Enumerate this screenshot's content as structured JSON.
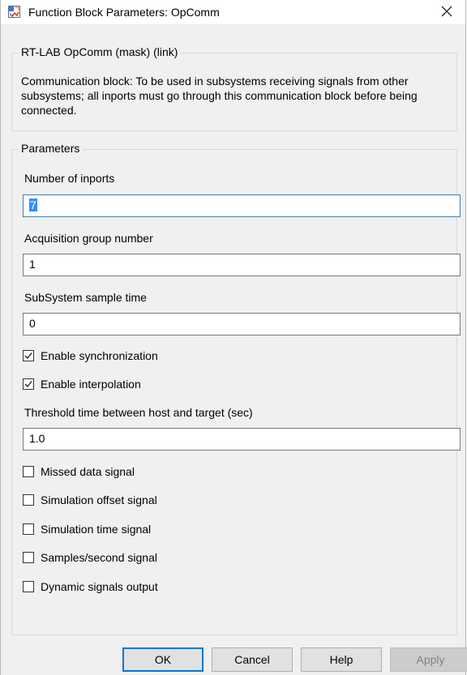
{
  "window": {
    "title": "Function Block Parameters: OpComm",
    "close_glyph": "✕"
  },
  "mask_group": {
    "legend": "RT-LAB OpComm (mask) (link)",
    "description": "Communication block: To be used in subsystems receiving signals from other subsystems; all inports must go through this communication block before being connected."
  },
  "params_group": {
    "legend": "Parameters",
    "num_inports": {
      "label": "Number of inports",
      "value": "7"
    },
    "acq_group": {
      "label": "Acquisition group number",
      "value": "1"
    },
    "sample_time": {
      "label": "SubSystem sample time",
      "value": "0"
    },
    "enable_sync": {
      "label": "Enable synchronization",
      "checked": true
    },
    "enable_interp": {
      "label": "Enable interpolation",
      "checked": true
    },
    "threshold": {
      "label": "Threshold time between host and target (sec)",
      "value": "1.0"
    },
    "missed_data": {
      "label": "Missed data signal",
      "checked": false
    },
    "sim_offset": {
      "label": "Simulation offset signal",
      "checked": false
    },
    "sim_time": {
      "label": "Simulation time signal",
      "checked": false
    },
    "samples_sec": {
      "label": "Samples/second signal",
      "checked": false
    },
    "dynamic_signals": {
      "label": "Dynamic signals output",
      "checked": false
    }
  },
  "buttons": {
    "ok": "OK",
    "cancel": "Cancel",
    "help": "Help",
    "apply": "Apply"
  },
  "colors": {
    "focus_border": "#3c7fb1",
    "selection": "#3390ff",
    "default_button_border": "#0078d7"
  }
}
